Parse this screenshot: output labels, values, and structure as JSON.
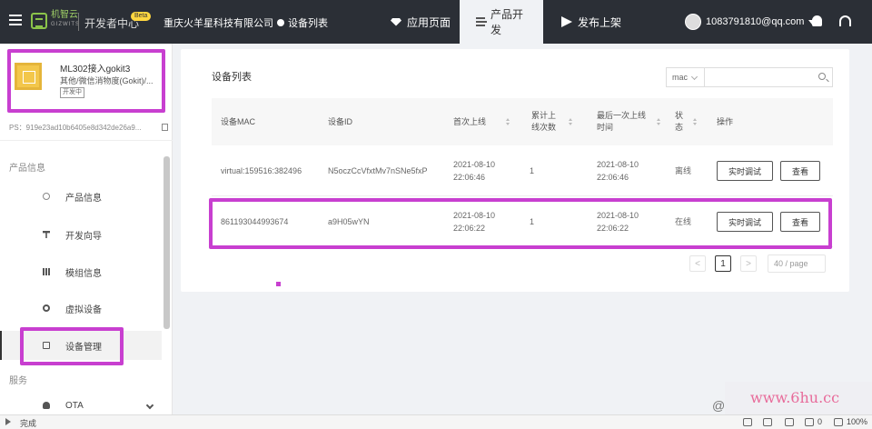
{
  "topbar": {
    "brand_cn": "机智云",
    "brand_en": "GIZWITS",
    "dev_center": "开发者中心",
    "badge": "Beta",
    "company": "重庆火羊星科技有限公司",
    "crumb_page": "设备列表",
    "tabs": [
      {
        "label": "应用页面",
        "icon": "gem-icon"
      },
      {
        "label": "产品开发",
        "icon": "sliders-icon",
        "active": true
      },
      {
        "label": "发布上架",
        "icon": "send-icon"
      }
    ],
    "user_email": "1083791810@qq.com"
  },
  "sidebar": {
    "product_name": "ML302接入gokit3",
    "product_category": "其他/微信消物度(Gokit)/...",
    "product_status": "开发中",
    "pk": "PS：919e23ad10b6405e8d342de26a9...",
    "section_product": "产品信息",
    "items": [
      {
        "label": "产品信息",
        "icon": "info-circle-icon"
      },
      {
        "label": "开发向导",
        "icon": "pin-icon"
      },
      {
        "label": "模组信息",
        "icon": "grid-icon"
      },
      {
        "label": "虚拟设备",
        "icon": "gear-icon"
      },
      {
        "label": "设备管理",
        "icon": "document-icon",
        "active": true
      }
    ],
    "section_service": "服务",
    "service_items": [
      {
        "label": "OTA",
        "icon": "cloud-icon"
      }
    ]
  },
  "main": {
    "title": "设备列表",
    "search_field_select": "mac",
    "search_placeholder": "",
    "columns": [
      {
        "label": "设备MAC"
      },
      {
        "label": "设备ID"
      },
      {
        "label": "首次上线"
      },
      {
        "label": "累计上线次数"
      },
      {
        "label": "最后一次上线时间"
      },
      {
        "label": "状态"
      },
      {
        "label": "操作"
      }
    ],
    "rows": [
      {
        "mac": "virtual:159516:382496",
        "did": "N5oczCcVfxtMv7nSNe5fxP",
        "first_online": "2021-08-10 22:06:46",
        "count": "1",
        "last_online": "2021-08-10 22:06:46",
        "status": "离线",
        "debug": "实时调试",
        "view": "查看"
      },
      {
        "mac": "861193044993674",
        "did": "a9H05wYN",
        "first_online": "2021-08-10 22:06:22",
        "count": "1",
        "last_online": "2021-08-10 22:06:22",
        "status": "在线",
        "debug": "实时调试",
        "view": "查看"
      }
    ],
    "pager": {
      "prev": "<",
      "current": "1",
      "next": ">",
      "page_size": "40 / page"
    }
  },
  "statusbar": {
    "left": "完成",
    "zoom": "100%",
    "count": "0"
  },
  "watermark": {
    "at": "@",
    "text": "www.6hu.cc"
  },
  "colors": {
    "topbar": "#2b2f36",
    "highlight": "#c83fd0",
    "brand_green": "#8bc34a"
  }
}
